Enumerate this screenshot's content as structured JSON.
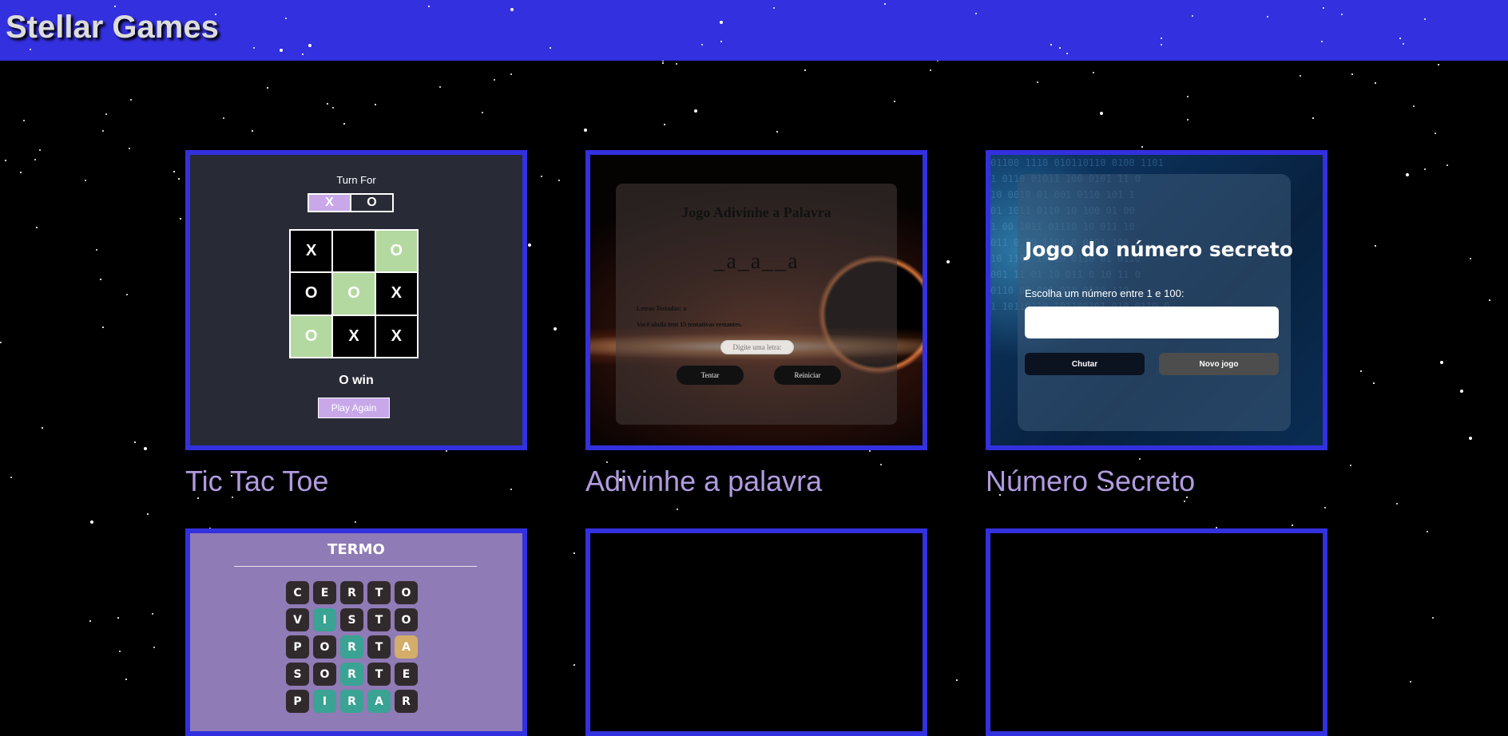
{
  "header": {
    "title": "Stellar Games",
    "background": "#3330df"
  },
  "games": [
    {
      "title": "Tic Tac Toe",
      "preview": {
        "turn_label": "Turn For",
        "turn_x": "X",
        "turn_o": "O",
        "board": [
          "X",
          "",
          "O",
          "O",
          "O",
          "X",
          "O",
          "X",
          "X"
        ],
        "winning_cells": [
          2,
          4,
          6
        ],
        "status": "O win",
        "button": "Play Again"
      }
    },
    {
      "title": "Adivinhe a palavra",
      "preview": {
        "heading": "Jogo Adivinhe a Palavra",
        "word": "_a_a__a",
        "letters_tried": "Letras Testadas: a",
        "tries_left": "Você ainda tem 15 tentativas restantes.",
        "input_placeholder": "Digite uma letra:",
        "try_button": "Tentar",
        "restart_button": "Reiniciar"
      }
    },
    {
      "title": "Número Secreto",
      "preview": {
        "heading": "Jogo do número secreto",
        "prompt": "Escolha um número entre 1 e 100:",
        "guess_button": "Chutar",
        "new_game_button": "Novo jogo"
      }
    },
    {
      "preview": {
        "heading": "TERMO",
        "rows": [
          {
            "letters": [
              "C",
              "E",
              "R",
              "T",
              "O"
            ],
            "states": [
              "",
              "",
              "",
              "",
              ""
            ]
          },
          {
            "letters": [
              "V",
              "I",
              "S",
              "T",
              "O"
            ],
            "states": [
              "",
              "right",
              "",
              "",
              ""
            ]
          },
          {
            "letters": [
              "P",
              "O",
              "R",
              "T",
              "A"
            ],
            "states": [
              "",
              "",
              "right",
              "",
              "place"
            ]
          },
          {
            "letters": [
              "S",
              "O",
              "R",
              "T",
              "E"
            ],
            "states": [
              "",
              "",
              "right",
              "",
              ""
            ]
          },
          {
            "letters": [
              "P",
              "I",
              "R",
              "A",
              "R"
            ],
            "states": [
              "",
              "right",
              "right",
              "right",
              ""
            ]
          }
        ]
      }
    },
    {
      "preview": {}
    },
    {
      "preview": {}
    }
  ],
  "colors": {
    "accent": "#3330df",
    "card_title": "#b19be0",
    "ttt_highlight": "#c8a8e8",
    "ttt_win_cell": "#b3d9a0",
    "termo_background": "#8f7bb5",
    "termo_right": "#3aa394",
    "termo_place": "#d3ad69"
  }
}
